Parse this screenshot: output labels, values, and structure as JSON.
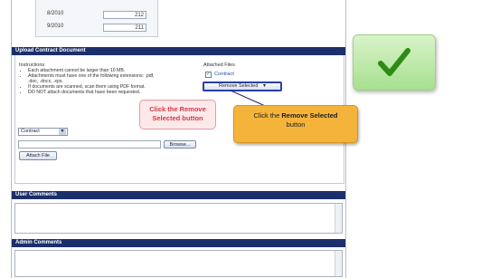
{
  "months": [
    {
      "label": "8/2010",
      "value": "212"
    },
    {
      "label": "9/2010",
      "value": "211"
    }
  ],
  "upload": {
    "title": "Upload Contract Document",
    "instructions_label": "Instructions",
    "instructions": [
      "Each attachment cannot be larger than 10 MB.",
      "Attachments must have one of the following extensions: .pdf, .doc, .docx, .xps.",
      "If documents are scanned, scan them using PDF format.",
      "DO NOT attach documents that have been requested."
    ],
    "attached_files_label": "Attached Files",
    "attached_file": "Contract",
    "remove_button": "Remove Selected",
    "doc_type": "Contract",
    "browse_button": "Browse...",
    "attach_button": "Attach File"
  },
  "callouts": {
    "red": "Click the Remove Selected button",
    "yellow_prefix": "Click the ",
    "yellow_bold": "Remove Selected",
    "yellow_suffix": " button"
  },
  "sections": {
    "user_comments": "User Comments",
    "admin_comments": "Admin Comments"
  },
  "colors": {
    "header_bar": "#1b2f6b",
    "check": "#2e8b17",
    "callout_yellow": "#f4b43b",
    "callout_red_text": "#d23a48"
  }
}
